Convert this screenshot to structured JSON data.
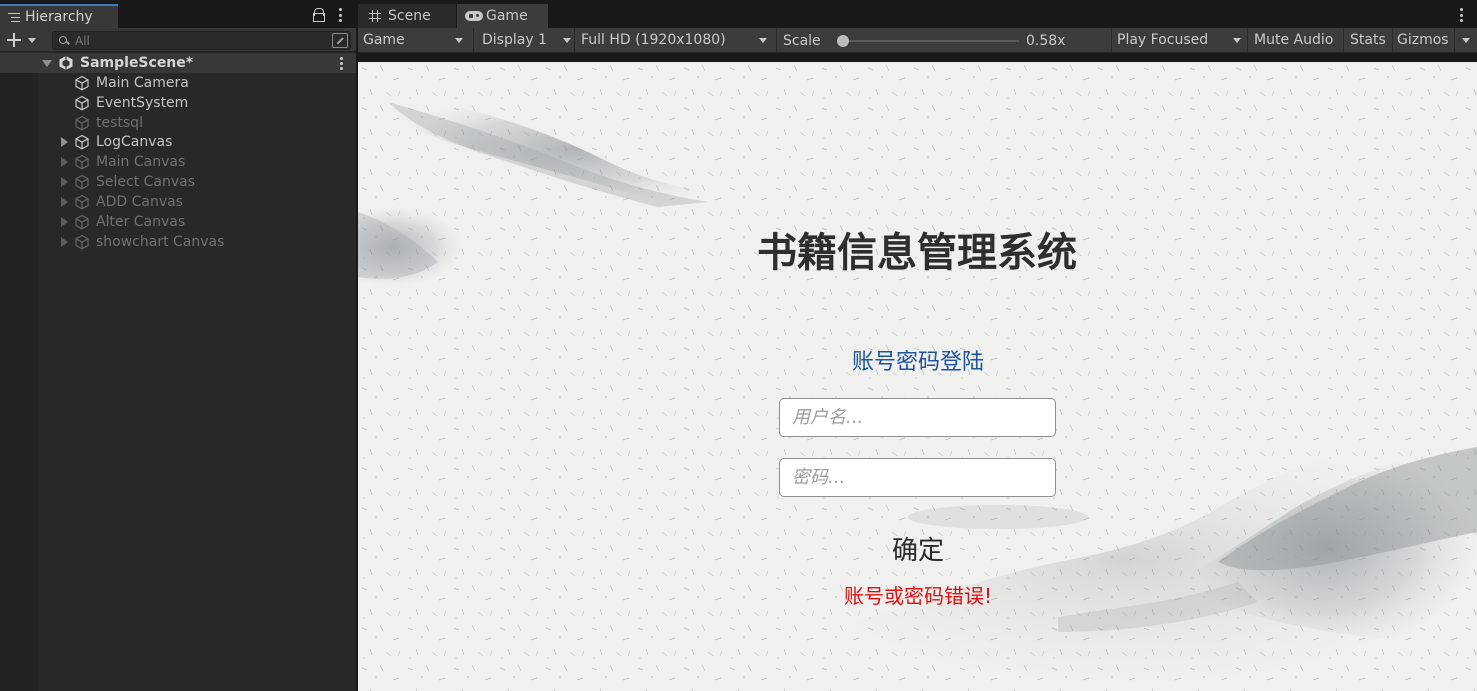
{
  "hierarchy": {
    "tab_label": "Hierarchy",
    "search_placeholder": "All",
    "tree": [
      {
        "label": "SampleScene*",
        "kind": "scene",
        "dim": false
      },
      {
        "label": "Main Camera",
        "kind": "object",
        "dim": false
      },
      {
        "label": "EventSystem",
        "kind": "object",
        "dim": false
      },
      {
        "label": "testsql",
        "kind": "object",
        "dim": true
      },
      {
        "label": "LogCanvas",
        "kind": "object",
        "dim": false
      },
      {
        "label": "Main Canvas",
        "kind": "object",
        "dim": true
      },
      {
        "label": "Select Canvas",
        "kind": "object",
        "dim": true
      },
      {
        "label": "ADD Canvas",
        "kind": "object",
        "dim": true
      },
      {
        "label": "Alter Canvas",
        "kind": "object",
        "dim": true
      },
      {
        "label": "showchart Canvas",
        "kind": "object",
        "dim": true
      }
    ]
  },
  "game_panel": {
    "tabs": [
      {
        "label": "Scene",
        "icon": "grid-icon"
      },
      {
        "label": "Game",
        "icon": "gamepad-icon"
      }
    ],
    "toolbar": {
      "view_mode": "Game",
      "display": "Display 1",
      "resolution": "Full HD (1920x1080)",
      "scale_label": "Scale",
      "scale_value": "0.58x",
      "play_mode": "Play Focused",
      "mute_audio": "Mute Audio",
      "stats": "Stats",
      "gizmos": "Gizmos"
    }
  },
  "login": {
    "title": "书籍信息管理系统",
    "subtitle": "账号密码登陆",
    "username_placeholder": "用户名...",
    "password_placeholder": "密码...",
    "confirm_label": "确定",
    "error_message": "账号或密码错误!"
  },
  "colors": {
    "accent": "#3a79bb",
    "subtitle": "#1d54a0",
    "error": "#e01010",
    "title": "#2e2e2e"
  }
}
